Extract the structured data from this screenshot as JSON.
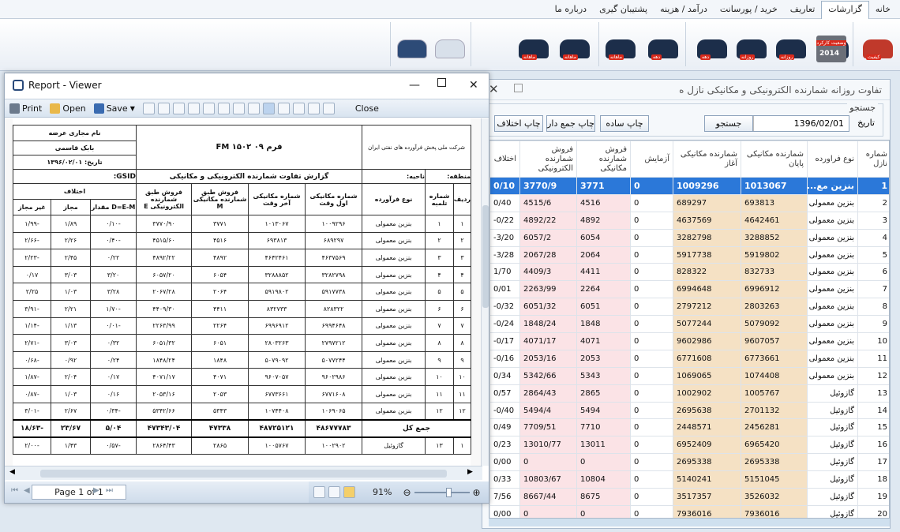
{
  "menu": {
    "tabs": [
      "خانه",
      "گزارشات",
      "تعاریف",
      "خرید / پورسانت",
      "درآمد / هزینه",
      "پشتیبان گیری",
      "درباره ما"
    ],
    "active_index": 1
  },
  "ribbon": {
    "icon_tags": [
      "کیفیت",
      "روزانه",
      "روزانه",
      "روزانه",
      "دهه",
      "دهه",
      "ماهانه",
      "ماهانه",
      "ماهانه"
    ],
    "calendar_banner": "وضعیت کارکرد",
    "calendar_year": "2014"
  },
  "main_window": {
    "title": "تفاوت روزانه شمارنده الکترونیکی و مکانیکی نازل ه",
    "search_group_label": "جستجو",
    "date_label": "تاریخ",
    "date_value": "1396/02/01",
    "buttons": {
      "search": "جستجو",
      "print_simple": "چاپ ساده",
      "print_total": "چاپ جمع دار",
      "print_diff": "چاپ اختلاف"
    }
  },
  "grid": {
    "columns": [
      "شماره نازل",
      "نوع فراورده",
      "شمارنده مکانیکی پایان",
      "شمارنده مکانیکی آغاز",
      "آزمایش",
      "فروش شمارنده مکانیکی",
      "فروش شمارنده الکترونیکی",
      "اختلاف"
    ],
    "rows": [
      [
        "1",
        "بنزین مع...",
        "1013067",
        "1009296",
        "0",
        "3771",
        "3770/9",
        "0/10"
      ],
      [
        "2",
        "بنزین معمولی",
        "693813",
        "689297",
        "0",
        "4516",
        "4515/6",
        "0/40"
      ],
      [
        "3",
        "بنزین معمولی",
        "4642461",
        "4637569",
        "0",
        "4892",
        "4892/22",
        "-0/22"
      ],
      [
        "4",
        "بنزین معمولی",
        "3288852",
        "3282798",
        "0",
        "6054",
        "6057/2",
        "-3/20"
      ],
      [
        "5",
        "بنزین معمولی",
        "5919802",
        "5917738",
        "0",
        "2064",
        "2067/28",
        "-3/28"
      ],
      [
        "6",
        "بنزین معمولی",
        "832733",
        "828322",
        "0",
        "4411",
        "4409/3",
        "1/70"
      ],
      [
        "7",
        "بنزین معمولی",
        "6996912",
        "6994648",
        "0",
        "2264",
        "2263/99",
        "0/01"
      ],
      [
        "8",
        "بنزین معمولی",
        "2803263",
        "2797212",
        "0",
        "6051",
        "6051/32",
        "-0/32"
      ],
      [
        "9",
        "بنزین معمولی",
        "5079092",
        "5077244",
        "0",
        "1848",
        "1848/24",
        "-0/24"
      ],
      [
        "10",
        "بنزین معمولی",
        "9607057",
        "9602986",
        "0",
        "4071",
        "4071/17",
        "-0/17"
      ],
      [
        "11",
        "بنزین معمولی",
        "6773661",
        "6771608",
        "0",
        "2053",
        "2053/16",
        "-0/16"
      ],
      [
        "12",
        "بنزین معمولی",
        "1074408",
        "1069065",
        "0",
        "5343",
        "5342/66",
        "0/34"
      ],
      [
        "13",
        "گازوئیل",
        "1005767",
        "1002902",
        "0",
        "2865",
        "2864/43",
        "0/57"
      ],
      [
        "14",
        "گازوئیل",
        "2701132",
        "2695638",
        "0",
        "5494",
        "5494/4",
        "-0/40"
      ],
      [
        "15",
        "گازوئیل",
        "2456281",
        "2448571",
        "0",
        "7710",
        "7709/51",
        "0/49"
      ],
      [
        "16",
        "گازوئیل",
        "6965420",
        "6952409",
        "0",
        "13011",
        "13010/77",
        "0/23"
      ],
      [
        "17",
        "گازوئیل",
        "2695338",
        "2695338",
        "0",
        "0",
        "0",
        "0/00"
      ],
      [
        "18",
        "گازوئیل",
        "5151045",
        "5140241",
        "0",
        "10804",
        "10803/67",
        "0/33"
      ],
      [
        "19",
        "گازوئیل",
        "3526032",
        "3517357",
        "0",
        "8675",
        "8667/44",
        "7/56"
      ],
      [
        "20",
        "گازوئیل",
        "7936016",
        "7936016",
        "0",
        "0",
        "0",
        "0/00"
      ]
    ]
  },
  "viewer": {
    "title": "Report - Viewer",
    "toolbar": {
      "print": "Print",
      "open": "Open",
      "save": "Save",
      "close": "Close"
    },
    "page_indicator": "Page 1 of 1",
    "zoom": "91%",
    "report": {
      "station_label": "نام مجاری عرضه",
      "station_name": "بابک قاسمی",
      "date_line": "تاریخ: ۱۳۹۶/۰۲/۰۱",
      "form_title": "فرم FM ۱۵۰۲ ۰۹",
      "report_title": "گزارش تفاوت شمارنده الکترونیکی و مکانیکی",
      "company": "شرکت ملی پخش فرآورده های نفتی ایران",
      "gsid": "GSID:",
      "region": "منطقه:",
      "area": "ناحیه:",
      "headers": [
        "ردیف",
        "شماره تلمبه",
        "نوع فرآورده",
        "شماره مکانیکی اول وقت",
        "شماره مکانیکی آخر وقت",
        "فروش طبق شمارنده مکانیکی M",
        "فروش طبق شمارنده الکترونیکی E",
        "اختلاف"
      ],
      "diff_sub": [
        "D=E-M مقدار",
        "مجاز",
        "غیر مجاز"
      ],
      "rows": [
        [
          "۱",
          "۱",
          "بنزین معمولی",
          "۱۰۰۹۲۹۶",
          "۱۰۱۳۰۶۷",
          "۳۷۷۱",
          "۳۷۷۰/۹۰",
          "-۰/۱۰",
          "۱/۸۹",
          "-۱/۹۹"
        ],
        [
          "۲",
          "۲",
          "بنزین معمولی",
          "۶۸۹۲۹۷",
          "۶۹۳۸۱۳",
          "۴۵۱۶",
          "۴۵۱۵/۶۰",
          "-۰/۴۰",
          "۲/۲۶",
          "-۲/۶۶"
        ],
        [
          "۳",
          "۳",
          "بنزین معمولی",
          "۴۶۳۷۵۶۹",
          "۴۶۴۲۴۶۱",
          "۴۸۹۲",
          "۴۸۹۲/۲۲",
          "۰/۲۲",
          "۲/۴۵",
          "-۲/۲۳"
        ],
        [
          "۴",
          "۴",
          "بنزین معمولی",
          "۳۲۸۲۷۹۸",
          "۳۲۸۸۸۵۲",
          "۶۰۵۴",
          "۶۰۵۷/۲۰",
          "۳/۲۰",
          "۳/۰۳",
          "۰/۱۷"
        ],
        [
          "۵",
          "۵",
          "بنزین معمولی",
          "۵۹۱۷۷۳۸",
          "۵۹۱۹۸۰۲",
          "۲۰۶۴",
          "۲۰۶۷/۲۸",
          "۳/۲۸",
          "۱/۰۳",
          "۲/۲۵"
        ],
        [
          "۶",
          "۶",
          "بنزین معمولی",
          "۸۲۸۳۲۲",
          "۸۳۲۷۳۳",
          "۴۴۱۱",
          "۴۴۰۹/۳۰",
          "-۱/۷۰",
          "۲/۲۱",
          "-۳/۹۱"
        ],
        [
          "۷",
          "۷",
          "بنزین معمولی",
          "۶۹۹۴۶۴۸",
          "۶۹۹۶۹۱۲",
          "۲۲۶۴",
          "۲۲۶۳/۹۹",
          "-۰/۰۱",
          "۱/۱۳",
          "-۱/۱۴"
        ],
        [
          "۸",
          "۸",
          "بنزین معمولی",
          "۲۷۹۷۲۱۲",
          "۲۸۰۳۲۶۳",
          "۶۰۵۱",
          "۶۰۵۱/۳۲",
          "۰/۳۲",
          "۳/۰۳",
          "-۲/۷۱"
        ],
        [
          "۹",
          "۹",
          "بنزین معمولی",
          "۵۰۷۷۲۴۴",
          "۵۰۷۹۰۹۲",
          "۱۸۴۸",
          "۱۸۴۸/۲۴",
          "۰/۲۴",
          "۰/۹۲",
          "-۰/۶۸"
        ],
        [
          "۱۰",
          "۱۰",
          "بنزین معمولی",
          "۹۶۰۲۹۸۶",
          "۹۶۰۷۰۵۷",
          "۴۰۷۱",
          "۴۰۷۱/۱۷",
          "۰/۱۷",
          "۲/۰۴",
          "-۱/۸۷"
        ],
        [
          "۱۱",
          "۱۱",
          "بنزین معمولی",
          "۶۷۷۱۶۰۸",
          "۶۷۷۳۶۶۱",
          "۲۰۵۳",
          "۲۰۵۳/۱۶",
          "۰/۱۶",
          "۱/۰۳",
          "-۰/۸۷"
        ],
        [
          "۱۲",
          "۱۲",
          "بنزین معمولی",
          "۱۰۶۹۰۶۵",
          "۱۰۷۴۴۰۸",
          "۵۳۴۳",
          "۵۳۴۲/۶۶",
          "-۰/۳۴",
          "۲/۶۷",
          "-۳/۰۱"
        ]
      ],
      "total_label": "جمع کل",
      "totals": [
        "۴۸۶۷۷۷۸۳",
        "۴۸۷۲۵۱۲۱",
        "۴۷۳۳۸",
        "۴۷۳۴۳/۰۴",
        "۵/۰۴",
        "۲۳/۶۷",
        "-۱۸/۶۳"
      ],
      "row13": [
        "۱",
        "۱۳",
        "گازوئیل",
        "۱۰۰۲۹۰۲",
        "۱۰۰۵۷۶۷",
        "۲۸۶۵",
        "۲۸۶۴/۴۳",
        "-۰/۵۷",
        "۱/۴۳",
        "-۲/۰۰"
      ]
    }
  },
  "colors": {
    "selected_row": "#2b78d9",
    "mechanical_bg": "#f5e1c4",
    "sales_bg": "#fbe3e6"
  }
}
